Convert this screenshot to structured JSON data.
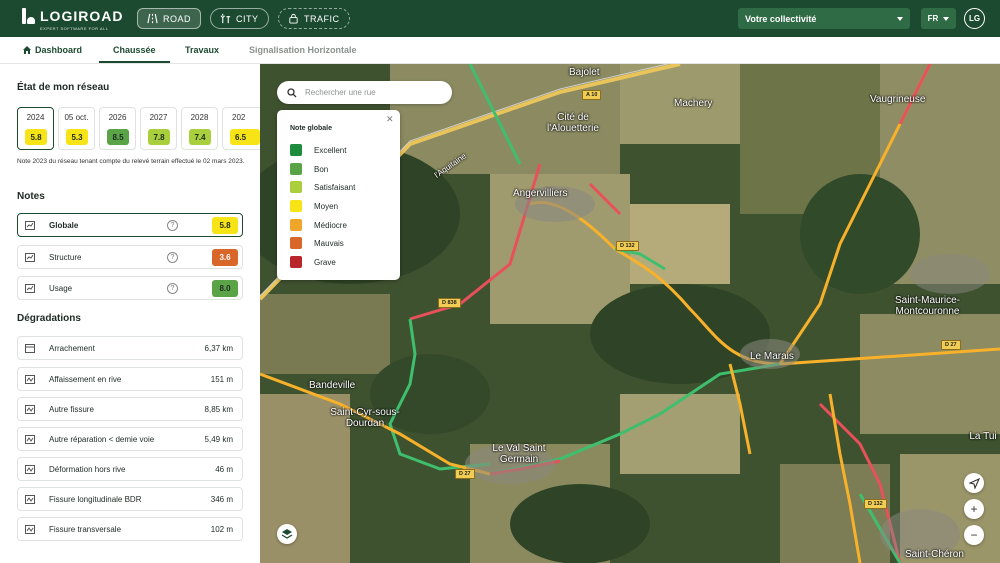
{
  "header": {
    "logo_name": "LOGIROAD",
    "logo_tagline": "EXPERT SOFTWARE FOR ALL",
    "modes": [
      {
        "label": "ROAD",
        "active": true
      },
      {
        "label": "CITY",
        "active": false
      },
      {
        "label": "TRAFIC",
        "active": false
      }
    ],
    "collectivite": "Votre collectivité",
    "language": "FR",
    "avatar_initials": "LG"
  },
  "tabs": [
    "Dashboard",
    "Chaussée",
    "Travaux",
    "Signalisation Horizontale"
  ],
  "network": {
    "title": "État de mon réseau",
    "years": [
      {
        "label": "2024",
        "value": "5.8",
        "color": "#f7e417",
        "selected": true
      },
      {
        "label": "05 oct.",
        "value": "5.3",
        "color": "#f7e417"
      },
      {
        "label": "2026",
        "value": "8.5",
        "color": "#5aa447"
      },
      {
        "label": "2027",
        "value": "7.8",
        "color": "#a9cf3c"
      },
      {
        "label": "2028",
        "value": "7.4",
        "color": "#a9cf3c"
      },
      {
        "label": "202",
        "value": "6.5",
        "color": "#f7e417"
      }
    ],
    "note": "Note 2023 du réseau tenant compte du relevé terrain effectué le 02 mars 2023."
  },
  "notes": {
    "title": "Notes",
    "items": [
      {
        "label": "Globale",
        "score": "5.8",
        "color": "#f7e417",
        "selected": true
      },
      {
        "label": "Structure",
        "score": "3.6",
        "color": "#d9672a"
      },
      {
        "label": "Usage",
        "score": "8.0",
        "color": "#5aa447"
      }
    ]
  },
  "degradations": {
    "title": "Dégradations",
    "items": [
      {
        "label": "Arrachement",
        "distance": "6,37 km"
      },
      {
        "label": "Affaissement en rive",
        "distance": "151 m"
      },
      {
        "label": "Autre fissure",
        "distance": "8,85 km"
      },
      {
        "label": "Autre réparation < demie voie",
        "distance": "5,49 km"
      },
      {
        "label": "Déformation hors rive",
        "distance": "46 m"
      },
      {
        "label": "Fissure longitudinale BDR",
        "distance": "346 m"
      },
      {
        "label": "Fissure transversale",
        "distance": "102 m"
      }
    ]
  },
  "map": {
    "search_placeholder": "Rechercher une rue",
    "legend": {
      "title": "Note globale",
      "items": [
        {
          "label": "Excellent",
          "color": "#1e8a3c"
        },
        {
          "label": "Bon",
          "color": "#5aa447"
        },
        {
          "label": "Satisfaisant",
          "color": "#a9cf3c"
        },
        {
          "label": "Moyen",
          "color": "#f7e417"
        },
        {
          "label": "Médiocre",
          "color": "#eea52a"
        },
        {
          "label": "Mauvais",
          "color": "#d9672a"
        },
        {
          "label": "Grave",
          "color": "#b8262a"
        }
      ]
    },
    "places": [
      "Bajolet",
      "Cité de l'Alouetterie",
      "Machery",
      "Vaugrineuse",
      "Angervilliers",
      "Saint-Maurice-Montcouronne",
      "Le Marais",
      "Bandeville",
      "Saint-Cyr-sous-Dourdan",
      "Le Val Saint Germain",
      "La Tui",
      "Saint-Chéron",
      "l'Aquitaine"
    ],
    "road_labels": [
      "A 10",
      "D 132",
      "D 838",
      "D 27",
      "D 27",
      "D 132"
    ]
  }
}
